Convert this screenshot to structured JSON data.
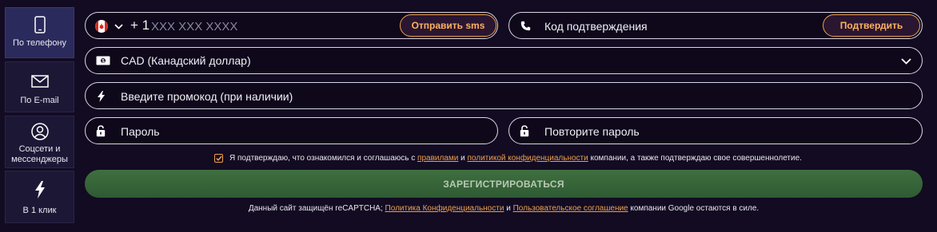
{
  "sidebar": {
    "items": [
      {
        "label": "По телефону",
        "icon": "phone-icon",
        "active": true
      },
      {
        "label": "По E-mail",
        "icon": "envelope-icon",
        "active": false
      },
      {
        "label": "Соцсети и мессенджеры",
        "icon": "user-circle-icon",
        "active": false
      },
      {
        "label": "В 1 клик",
        "icon": "lightning-icon",
        "active": false
      }
    ]
  },
  "phone": {
    "country_flag": "canada-flag-icon",
    "prefix": "+ 1",
    "placeholder": "XXX XXX XXXX",
    "send_sms_label": "Отправить sms"
  },
  "code": {
    "placeholder": "Код подтверждения",
    "confirm_label": "Подтвердить"
  },
  "currency": {
    "selected": "CAD (Канадский доллар)"
  },
  "promo": {
    "placeholder": "Введите промокод (при наличии)"
  },
  "password": {
    "placeholder": "Пароль",
    "repeat_placeholder": "Повторите пароль"
  },
  "consent": {
    "checked": true,
    "text_before": "Я подтверждаю, что ознакомился и соглашаюсь с",
    "rules_link": "правилами",
    "and": "и",
    "privacy_link": "политикой конфиденциальности",
    "text_after": "компании, а также подтверждаю свое совершеннолетие."
  },
  "register_label": "ЗАРЕГИСТРИРОВАТЬСЯ",
  "recaptcha": {
    "text_before": "Данный сайт защищён reCAPTCHA;",
    "privacy_link": "Политика Конфиденциальности",
    "and": "и",
    "terms_link": "Пользовательское соглашение",
    "text_after": "компании Google остаются в силе."
  },
  "colors": {
    "background": "#120b22",
    "accent": "#f0a04b",
    "register_button": "#3f6f3f",
    "active_tab": "#2b2a5c"
  }
}
